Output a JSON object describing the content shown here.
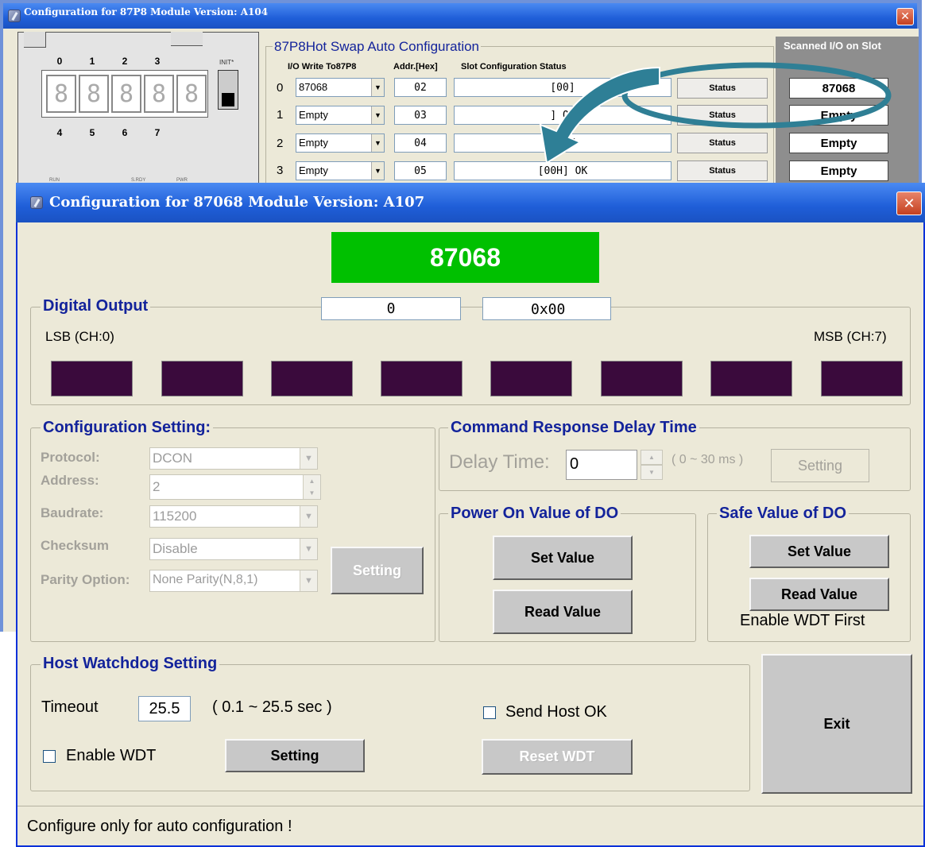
{
  "bg_window": {
    "title": "Configuration for 87P8 Module Version: A104",
    "close": "✕",
    "module": {
      "top_labels": [
        "0",
        "1",
        "2",
        "3"
      ],
      "bottom_labels": [
        "4",
        "5",
        "6",
        "7"
      ],
      "init_label": "INIT*",
      "footer_labels": [
        "RUN",
        "S.RDY",
        "PWR"
      ]
    },
    "group_title": "87P8Hot Swap Auto Configuration",
    "headers": {
      "io": "I/O Write To87P8",
      "addr": "Addr.[Hex]",
      "status": "Slot Configuration Status"
    },
    "rows": [
      {
        "idx": "0",
        "module": "87068",
        "addr": "02",
        "status": "[00]",
        "btn": "Status",
        "scanned": "87068"
      },
      {
        "idx": "1",
        "module": "Empty",
        "addr": "03",
        "status": "] OK",
        "btn": "Status",
        "scanned": "Empty"
      },
      {
        "idx": "2",
        "module": "Empty",
        "addr": "04",
        "status": "] OK",
        "btn": "Status",
        "scanned": "Empty"
      },
      {
        "idx": "3",
        "module": "Empty",
        "addr": "05",
        "status": "[00H] OK",
        "btn": "Status",
        "scanned": "Empty"
      }
    ],
    "scanned_title": "Scanned I/O on Slot"
  },
  "dialog": {
    "title": "Configuration for 87068 Module Version: A107",
    "close": "✕",
    "module_banner": "87068",
    "banner_color": "#00c000",
    "digital_output": {
      "title": "Digital Output",
      "value_dec": "0",
      "value_hex": "0x00",
      "lsb_label": "LSB (CH:0)",
      "msb_label": "MSB (CH:7)",
      "channels": [
        0,
        0,
        0,
        0,
        0,
        0,
        0,
        0
      ],
      "led_color": "#3a0a3c"
    },
    "config": {
      "title": "Configuration Setting:",
      "protocol_label": "Protocol:",
      "protocol_value": "DCON",
      "address_label": "Address:",
      "address_value": "2",
      "baudrate_label": "Baudrate:",
      "baudrate_value": "115200",
      "checksum_label": "Checksum",
      "checksum_value": "Disable",
      "parity_label": "Parity Option:",
      "parity_value": "None Parity(N,8,1)",
      "setting_btn": "Setting"
    },
    "delay": {
      "title": "Command Response Delay Time",
      "label": "Delay Time:",
      "value": "0",
      "range": "( 0 ~ 30 ms )",
      "setting_btn": "Setting"
    },
    "power_on": {
      "title": "Power On Value of DO",
      "set_btn": "Set Value",
      "read_btn": "Read Value"
    },
    "safe": {
      "title": "Safe Value of DO",
      "set_btn": "Set Value",
      "read_btn": "Read Value",
      "note": "Enable WDT First"
    },
    "watchdog": {
      "title": "Host Watchdog Setting",
      "timeout_label": "Timeout",
      "timeout_value": "25.5",
      "timeout_range": "( 0.1 ~ 25.5 sec )",
      "enable_label": "Enable WDT",
      "setting_btn": "Setting",
      "send_host_label": "Send Host OK",
      "reset_btn": "Reset WDT"
    },
    "exit_btn": "Exit",
    "status_bar": "Configure only for auto configuration !"
  }
}
